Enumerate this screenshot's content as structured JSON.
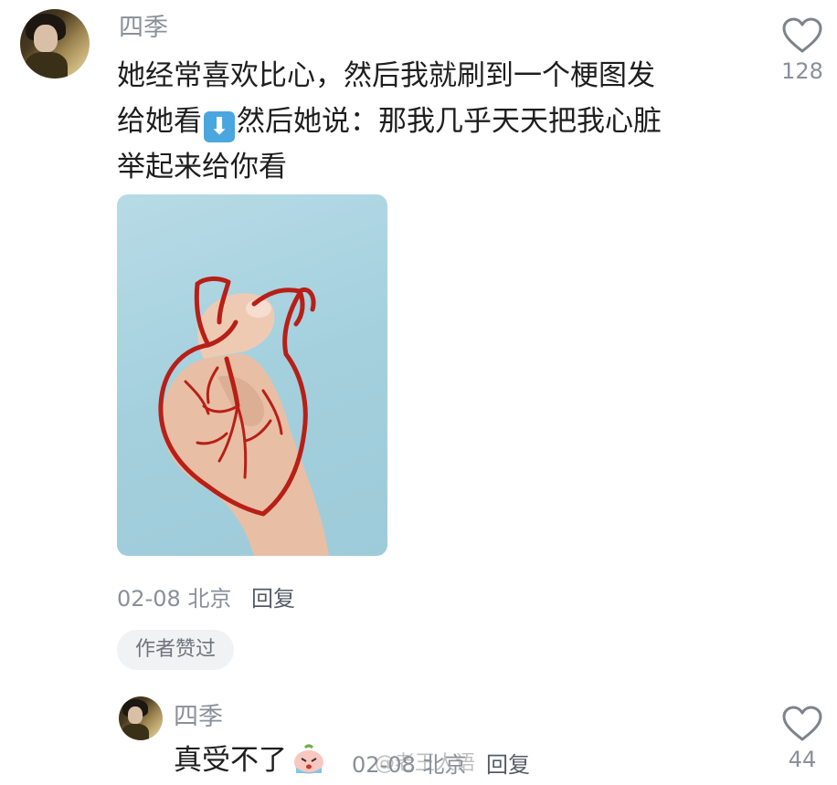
{
  "comment": {
    "username": "四季",
    "text_line1": "她经常喜欢比心，然后我就刷到一个梗图发",
    "text_line2a": "给她看",
    "arrow_emoji": "⬇",
    "text_line2b": "然后她说：那我几乎天天把我心脏",
    "text_line3": "举起来给你看",
    "date": "02-08",
    "location": "北京",
    "reply_label": "回复",
    "author_liked_badge": "作者赞过",
    "like_count": "128",
    "image_icon": "heart-hand-photo"
  },
  "reply": {
    "username": "四季",
    "text": "真受不了",
    "sticker_icon": "crying-emoji",
    "date": "02-08",
    "location": "北京",
    "reply_label": "回复",
    "like_count": "44"
  },
  "watermark": "@老王人语",
  "colors": {
    "meta_gray": "#8a8f99",
    "text": "#1e1e1e",
    "photo_bg": "#a4d0de",
    "heart_red": "#b81f17"
  }
}
